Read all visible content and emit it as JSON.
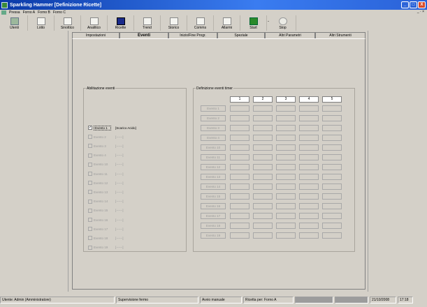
{
  "window": {
    "title": "Sparkling Hammer   [Definizione Ricette]",
    "controls": [
      "_",
      "□",
      "X"
    ]
  },
  "menubar": {
    "items": [
      "Pressa",
      "Forno A",
      "Forno B",
      "Forno C"
    ],
    "right": "_ · ×"
  },
  "toolbar": {
    "items": [
      {
        "label": "Utenti",
        "icon": "users-icon"
      },
      {
        "label": "Lotto",
        "icon": "document-icon"
      },
      {
        "label": "Sinottico",
        "icon": "document-icon"
      },
      {
        "label": "Analitico",
        "icon": "document-icon"
      },
      {
        "label": "Ricette",
        "icon": "recipe-icon"
      },
      {
        "label": "Trend",
        "icon": "document-icon"
      },
      {
        "label": "Storico",
        "icon": "document-icon"
      },
      {
        "label": "Comms",
        "icon": "document-icon"
      },
      {
        "label": "Allarmi",
        "icon": "document-icon"
      },
      {
        "label": "Start",
        "icon": "start-icon"
      },
      {
        "label": "Stop",
        "icon": "stop-icon"
      }
    ],
    "separator": "-"
  },
  "tabs": [
    {
      "label": "Impostazioni",
      "active": false
    },
    {
      "label": "Eventi",
      "active": true
    },
    {
      "label": "Inizio/Fine Progr.",
      "active": false
    },
    {
      "label": "Speziale",
      "active": false
    },
    {
      "label": "Altri Parametri",
      "active": false
    },
    {
      "label": "Altri Strumenti",
      "active": false
    }
  ],
  "abilitazione": {
    "title": "Abilitazione eventi",
    "rows": [
      {
        "name": "Evento 1",
        "value": "[Scarico Acido]",
        "checked": true,
        "enabled": true
      },
      {
        "name": "Evento 2",
        "value": "[------]",
        "checked": false,
        "enabled": false
      },
      {
        "name": "Evento 3",
        "value": "[------]",
        "checked": false,
        "enabled": false
      },
      {
        "name": "Evento 4",
        "value": "[------]",
        "checked": false,
        "enabled": false
      },
      {
        "name": "Evento 10",
        "value": "[------]",
        "checked": false,
        "enabled": false
      },
      {
        "name": "Evento 11",
        "value": "[------]",
        "checked": false,
        "enabled": false
      },
      {
        "name": "Evento 12",
        "value": "[------]",
        "checked": false,
        "enabled": false
      },
      {
        "name": "Evento 13",
        "value": "[------]",
        "checked": false,
        "enabled": false
      },
      {
        "name": "Evento 14",
        "value": "[------]",
        "checked": false,
        "enabled": false
      },
      {
        "name": "Evento 15",
        "value": "[------]",
        "checked": false,
        "enabled": false
      },
      {
        "name": "Evento 16",
        "value": "[------]",
        "checked": false,
        "enabled": false
      },
      {
        "name": "Evento 17",
        "value": "[------]",
        "checked": false,
        "enabled": false
      },
      {
        "name": "Evento 18",
        "value": "[------]",
        "checked": false,
        "enabled": false
      },
      {
        "name": "Evento 19",
        "value": "[------]",
        "checked": false,
        "enabled": false
      }
    ]
  },
  "timer": {
    "title": "Definizione eventi timer",
    "columns": [
      "1",
      "2",
      "3",
      "4",
      "5"
    ],
    "rows": [
      "Evento 1",
      "Evento 2",
      "Evento 3",
      "Evento 4",
      "Evento 10",
      "Evento 11",
      "Evento 12",
      "Evento 13",
      "Evento 14",
      "Evento 15",
      "Evento 16",
      "Evento 17",
      "Evento 18",
      "Evento 19"
    ]
  },
  "statusbar": {
    "user": "Utente: Admin (Amministratore)",
    "supervision": "Supervisione fermo",
    "mode": "Avvio manuale",
    "recipe": "Ricetta per: Forno A",
    "date": "21/10/2008",
    "time": "17:18"
  },
  "colors": {
    "title_start": "#0a3aa8",
    "title_end": "#3a7cf0",
    "face": "#d4d0c8"
  }
}
